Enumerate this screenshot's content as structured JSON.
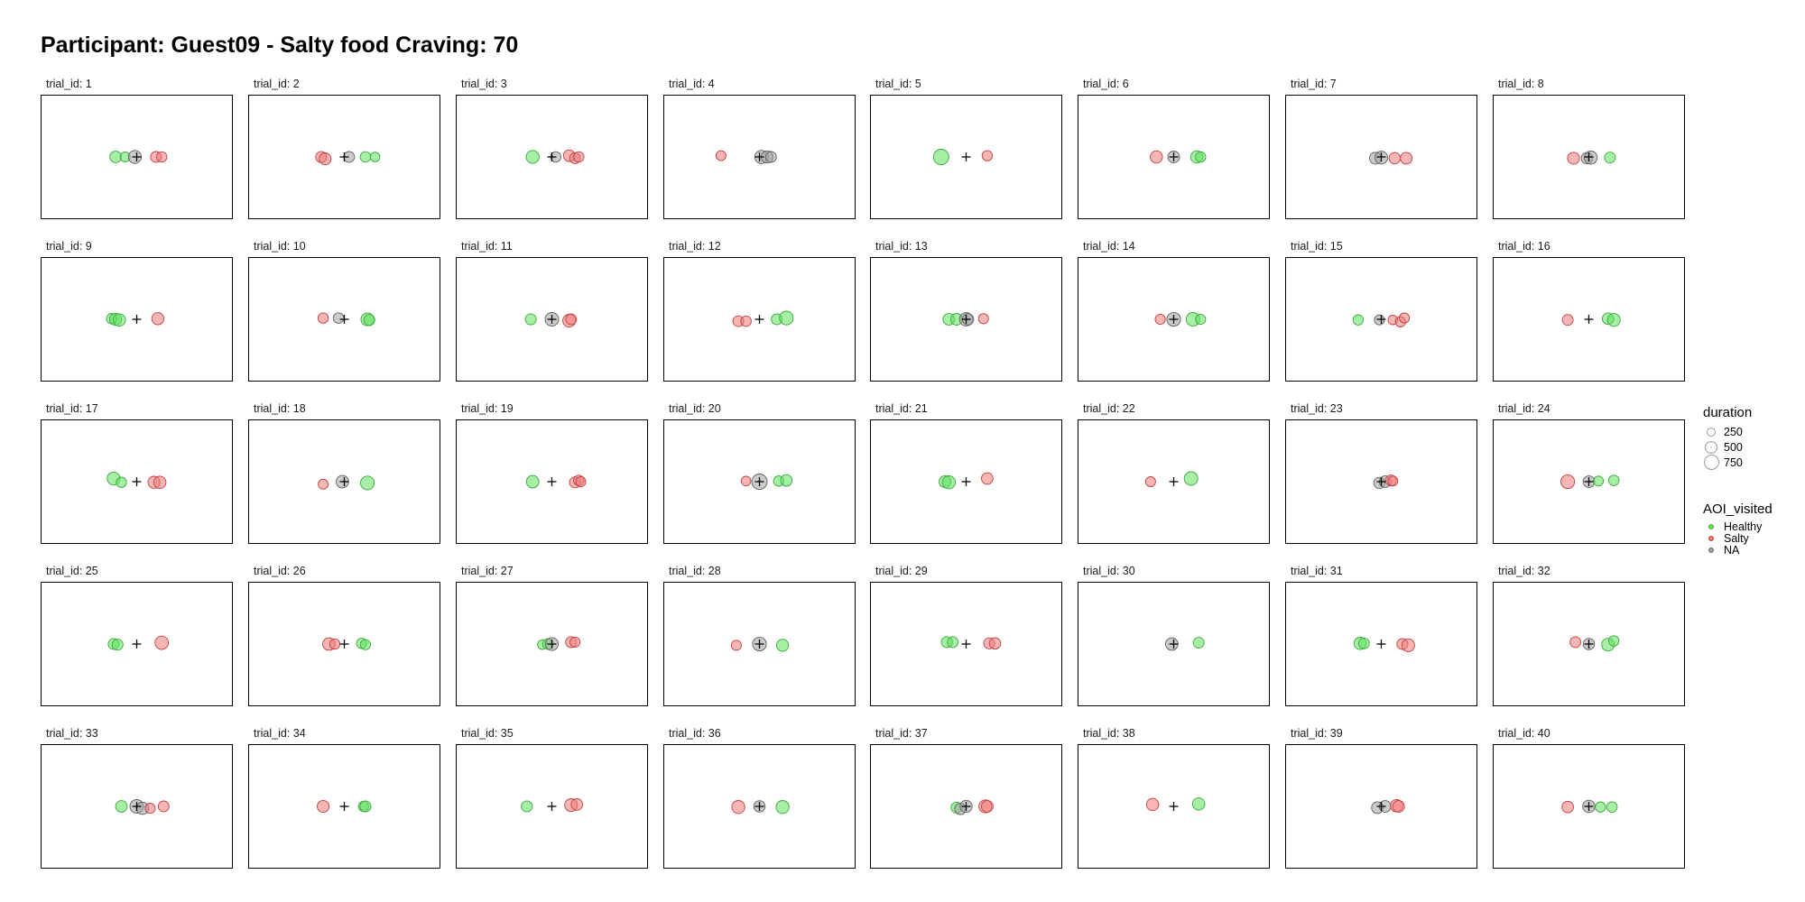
{
  "title": "Participant: Guest09 - Salty food Craving: 70",
  "colors": {
    "Healthy": "#5ee05e",
    "Salty": "#ee7a7a",
    "NA": "#a0a0a0"
  },
  "legend": {
    "duration": {
      "title": "duration",
      "values": [
        "250",
        "500",
        "750"
      ]
    },
    "aoi": {
      "title": "AOI_visited",
      "items": [
        "Healthy",
        "Salty",
        "NA"
      ]
    }
  },
  "chart_data": {
    "type": "scatter",
    "facet_label_prefix": "trial_id: ",
    "xlim": [
      -1,
      1
    ],
    "ylim": [
      -1,
      1
    ],
    "center_cross": [
      0,
      0
    ],
    "trials": [
      {
        "id": 1,
        "points": [
          [
            -0.22,
            0,
            0,
            380
          ],
          [
            -0.12,
            0,
            0,
            230
          ],
          [
            -0.02,
            0,
            2,
            560
          ],
          [
            0.2,
            0,
            1,
            300
          ],
          [
            0.26,
            0,
            1,
            260
          ]
        ]
      },
      {
        "id": 2,
        "points": [
          [
            -0.24,
            0,
            1,
            320
          ],
          [
            -0.2,
            -0.03,
            1,
            420
          ],
          [
            0.05,
            0,
            2,
            300
          ],
          [
            0.22,
            0,
            0,
            280
          ],
          [
            0.32,
            0,
            0,
            200
          ]
        ]
      },
      {
        "id": 3,
        "points": [
          [
            -0.2,
            0,
            0,
            560
          ],
          [
            0.04,
            0,
            2,
            280
          ],
          [
            0.18,
            0.02,
            1,
            380
          ],
          [
            0.24,
            -0.02,
            1,
            300
          ],
          [
            0.28,
            0,
            1,
            280
          ]
        ]
      },
      {
        "id": 4,
        "points": [
          [
            -0.4,
            0.02,
            1,
            230
          ],
          [
            0.02,
            0,
            2,
            580
          ],
          [
            0.08,
            0,
            2,
            440
          ],
          [
            0.12,
            0,
            2,
            300
          ]
        ]
      },
      {
        "id": 5,
        "points": [
          [
            -0.26,
            0,
            0,
            900
          ],
          [
            0.22,
            0.02,
            1,
            260
          ]
        ]
      },
      {
        "id": 6,
        "points": [
          [
            -0.18,
            0,
            1,
            460
          ],
          [
            0,
            0,
            2,
            400
          ],
          [
            0.24,
            0,
            0,
            460
          ],
          [
            0.28,
            0,
            0,
            260
          ]
        ]
      },
      {
        "id": 7,
        "points": [
          [
            -0.06,
            -0.02,
            2,
            420
          ],
          [
            0,
            -0.01,
            2,
            540
          ],
          [
            0.14,
            -0.02,
            1,
            360
          ],
          [
            0.26,
            -0.02,
            1,
            400
          ]
        ]
      },
      {
        "id": 8,
        "points": [
          [
            -0.16,
            -0.02,
            1,
            420
          ],
          [
            -0.02,
            -0.02,
            2,
            360
          ],
          [
            0.02,
            -0.01,
            2,
            560
          ],
          [
            0.22,
            -0.01,
            0,
            300
          ]
        ]
      },
      {
        "id": 9,
        "points": [
          [
            -0.26,
            0.01,
            0,
            280
          ],
          [
            -0.22,
            0,
            0,
            420
          ],
          [
            -0.18,
            -0.01,
            0,
            460
          ],
          [
            0.22,
            0.01,
            1,
            440
          ]
        ]
      },
      {
        "id": 10,
        "points": [
          [
            -0.22,
            0.02,
            1,
            260
          ],
          [
            -0.06,
            0.02,
            2,
            280
          ],
          [
            0.24,
            0,
            0,
            520
          ],
          [
            0.26,
            -0.01,
            0,
            320
          ]
        ]
      },
      {
        "id": 11,
        "points": [
          [
            -0.22,
            0,
            0,
            320
          ],
          [
            0,
            0,
            2,
            620
          ],
          [
            0.18,
            -0.02,
            1,
            540
          ],
          [
            0.2,
            0,
            1,
            300
          ]
        ]
      },
      {
        "id": 12,
        "points": [
          [
            -0.22,
            -0.03,
            1,
            300
          ],
          [
            -0.14,
            -0.03,
            1,
            280
          ],
          [
            0.18,
            0,
            0,
            300
          ],
          [
            0.28,
            0.02,
            0,
            640
          ]
        ]
      },
      {
        "id": 13,
        "points": [
          [
            -0.18,
            0,
            0,
            380
          ],
          [
            -0.1,
            0,
            0,
            400
          ],
          [
            0,
            0,
            2,
            600
          ],
          [
            0.02,
            0,
            2,
            360
          ],
          [
            0.18,
            0.01,
            1,
            240
          ]
        ]
      },
      {
        "id": 14,
        "points": [
          [
            -0.14,
            0,
            1,
            240
          ],
          [
            0,
            0,
            2,
            660
          ],
          [
            0.2,
            0,
            0,
            620
          ],
          [
            0.28,
            0,
            0,
            240
          ]
        ]
      },
      {
        "id": 15,
        "points": [
          [
            -0.24,
            -0.01,
            0,
            260
          ],
          [
            -0.02,
            -0.01,
            2,
            230
          ],
          [
            0.12,
            -0.01,
            1,
            200
          ],
          [
            0.2,
            -0.04,
            1,
            260
          ],
          [
            0.24,
            0.02,
            1,
            240
          ]
        ]
      },
      {
        "id": 16,
        "points": [
          [
            -0.22,
            -0.01,
            1,
            300
          ],
          [
            0.2,
            0.01,
            0,
            380
          ],
          [
            0.26,
            -0.01,
            0,
            540
          ]
        ]
      },
      {
        "id": 17,
        "points": [
          [
            -0.24,
            0.05,
            0,
            540
          ],
          [
            -0.16,
            -0.01,
            0,
            260
          ],
          [
            0.18,
            -0.01,
            1,
            440
          ],
          [
            0.24,
            -0.01,
            1,
            460
          ]
        ]
      },
      {
        "id": 18,
        "points": [
          [
            -0.22,
            -0.04,
            1,
            220
          ],
          [
            -0.02,
            0,
            2,
            480
          ],
          [
            0.24,
            -0.02,
            0,
            660
          ]
        ]
      },
      {
        "id": 19,
        "points": [
          [
            -0.2,
            0,
            0,
            480
          ],
          [
            0.24,
            -0.01,
            1,
            320
          ],
          [
            0.28,
            0.02,
            1,
            280
          ],
          [
            0.3,
            0,
            1,
            240
          ]
        ]
      },
      {
        "id": 20,
        "points": [
          [
            -0.14,
            0.01,
            1,
            200
          ],
          [
            0,
            0,
            2,
            900
          ],
          [
            0.2,
            0.01,
            0,
            260
          ],
          [
            0.28,
            0.02,
            0,
            380
          ]
        ]
      },
      {
        "id": 21,
        "points": [
          [
            -0.22,
            0,
            0,
            420
          ],
          [
            -0.18,
            -0.01,
            0,
            560
          ],
          [
            0.22,
            0.05,
            1,
            380
          ]
        ]
      },
      {
        "id": 22,
        "points": [
          [
            -0.24,
            0,
            1,
            230
          ],
          [
            0.18,
            0.05,
            0,
            620
          ]
        ]
      },
      {
        "id": 23,
        "points": [
          [
            -0.02,
            -0.02,
            2,
            340
          ],
          [
            0.04,
            0,
            2,
            380
          ],
          [
            0.1,
            0.02,
            1,
            300
          ],
          [
            0.12,
            0.01,
            1,
            220
          ]
        ]
      },
      {
        "id": 24,
        "points": [
          [
            -0.22,
            0,
            1,
            660
          ],
          [
            0,
            0,
            2,
            380
          ],
          [
            0.1,
            0.01,
            0,
            220
          ],
          [
            0.26,
            0.02,
            0,
            280
          ]
        ]
      },
      {
        "id": 25,
        "points": [
          [
            -0.24,
            0,
            0,
            300
          ],
          [
            -0.2,
            -0.01,
            0,
            320
          ],
          [
            0.26,
            0.02,
            1,
            600
          ]
        ]
      },
      {
        "id": 26,
        "points": [
          [
            -0.16,
            0,
            1,
            480
          ],
          [
            -0.1,
            0,
            1,
            260
          ],
          [
            0.18,
            0.01,
            0,
            260
          ],
          [
            0.22,
            -0.01,
            0,
            240
          ]
        ]
      },
      {
        "id": 27,
        "points": [
          [
            -0.1,
            -0.01,
            0,
            200
          ],
          [
            -0.04,
            0,
            0,
            300
          ],
          [
            0,
            0,
            2,
            540
          ],
          [
            0.2,
            0.03,
            1,
            320
          ],
          [
            0.24,
            0.03,
            1,
            240
          ]
        ]
      },
      {
        "id": 28,
        "points": [
          [
            -0.24,
            -0.02,
            1,
            240
          ],
          [
            0,
            0,
            2,
            660
          ],
          [
            0.24,
            -0.02,
            0,
            440
          ]
        ]
      },
      {
        "id": 29,
        "points": [
          [
            -0.2,
            0.03,
            0,
            320
          ],
          [
            -0.14,
            0.03,
            0,
            300
          ],
          [
            0.24,
            0.01,
            1,
            320
          ],
          [
            0.3,
            0.01,
            1,
            360
          ]
        ]
      },
      {
        "id": 30,
        "points": [
          [
            -0.02,
            0,
            2,
            480
          ],
          [
            0.26,
            0.02,
            0,
            300
          ]
        ]
      },
      {
        "id": 31,
        "points": [
          [
            -0.22,
            0.01,
            0,
            460
          ],
          [
            -0.18,
            0.01,
            0,
            300
          ],
          [
            0.22,
            0,
            1,
            320
          ],
          [
            0.28,
            -0.02,
            1,
            520
          ]
        ]
      },
      {
        "id": 32,
        "points": [
          [
            -0.14,
            0.03,
            1,
            300
          ],
          [
            0,
            0,
            2,
            360
          ],
          [
            0.2,
            -0.01,
            0,
            520
          ],
          [
            0.26,
            0.05,
            0,
            260
          ]
        ]
      },
      {
        "id": 33,
        "points": [
          [
            -0.16,
            0,
            0,
            380
          ],
          [
            0,
            0,
            2,
            620
          ],
          [
            0.06,
            -0.03,
            2,
            460
          ],
          [
            0.14,
            -0.03,
            1,
            240
          ],
          [
            0.28,
            0,
            1,
            300
          ]
        ]
      },
      {
        "id": 34,
        "points": [
          [
            -0.22,
            0,
            1,
            420
          ],
          [
            0.2,
            0,
            0,
            260
          ],
          [
            0.22,
            0,
            0,
            320
          ]
        ]
      },
      {
        "id": 35,
        "points": [
          [
            -0.26,
            0,
            0,
            320
          ],
          [
            0.2,
            0.02,
            1,
            520
          ],
          [
            0.26,
            0.03,
            1,
            380
          ]
        ]
      },
      {
        "id": 36,
        "points": [
          [
            -0.22,
            -0.01,
            1,
            560
          ],
          [
            0,
            0,
            2,
            360
          ],
          [
            0.24,
            -0.01,
            0,
            560
          ]
        ]
      },
      {
        "id": 37,
        "points": [
          [
            -0.1,
            -0.02,
            0,
            320
          ],
          [
            -0.06,
            -0.04,
            2,
            360
          ],
          [
            0,
            0,
            2,
            440
          ],
          [
            0.2,
            0,
            1,
            560
          ],
          [
            0.22,
            0,
            1,
            400
          ]
        ]
      },
      {
        "id": 38,
        "points": [
          [
            -0.22,
            0.03,
            1,
            460
          ],
          [
            0.26,
            0.04,
            0,
            460
          ]
        ]
      },
      {
        "id": 39,
        "points": [
          [
            -0.04,
            -0.02,
            2,
            400
          ],
          [
            0.04,
            0,
            2,
            380
          ],
          [
            0.16,
            0.01,
            1,
            480
          ],
          [
            0.18,
            0,
            1,
            400
          ]
        ]
      },
      {
        "id": 40,
        "points": [
          [
            -0.22,
            -0.01,
            1,
            380
          ],
          [
            0,
            0,
            2,
            460
          ],
          [
            0.12,
            -0.01,
            0,
            260
          ],
          [
            0.24,
            -0.01,
            0,
            280
          ]
        ]
      }
    ]
  }
}
